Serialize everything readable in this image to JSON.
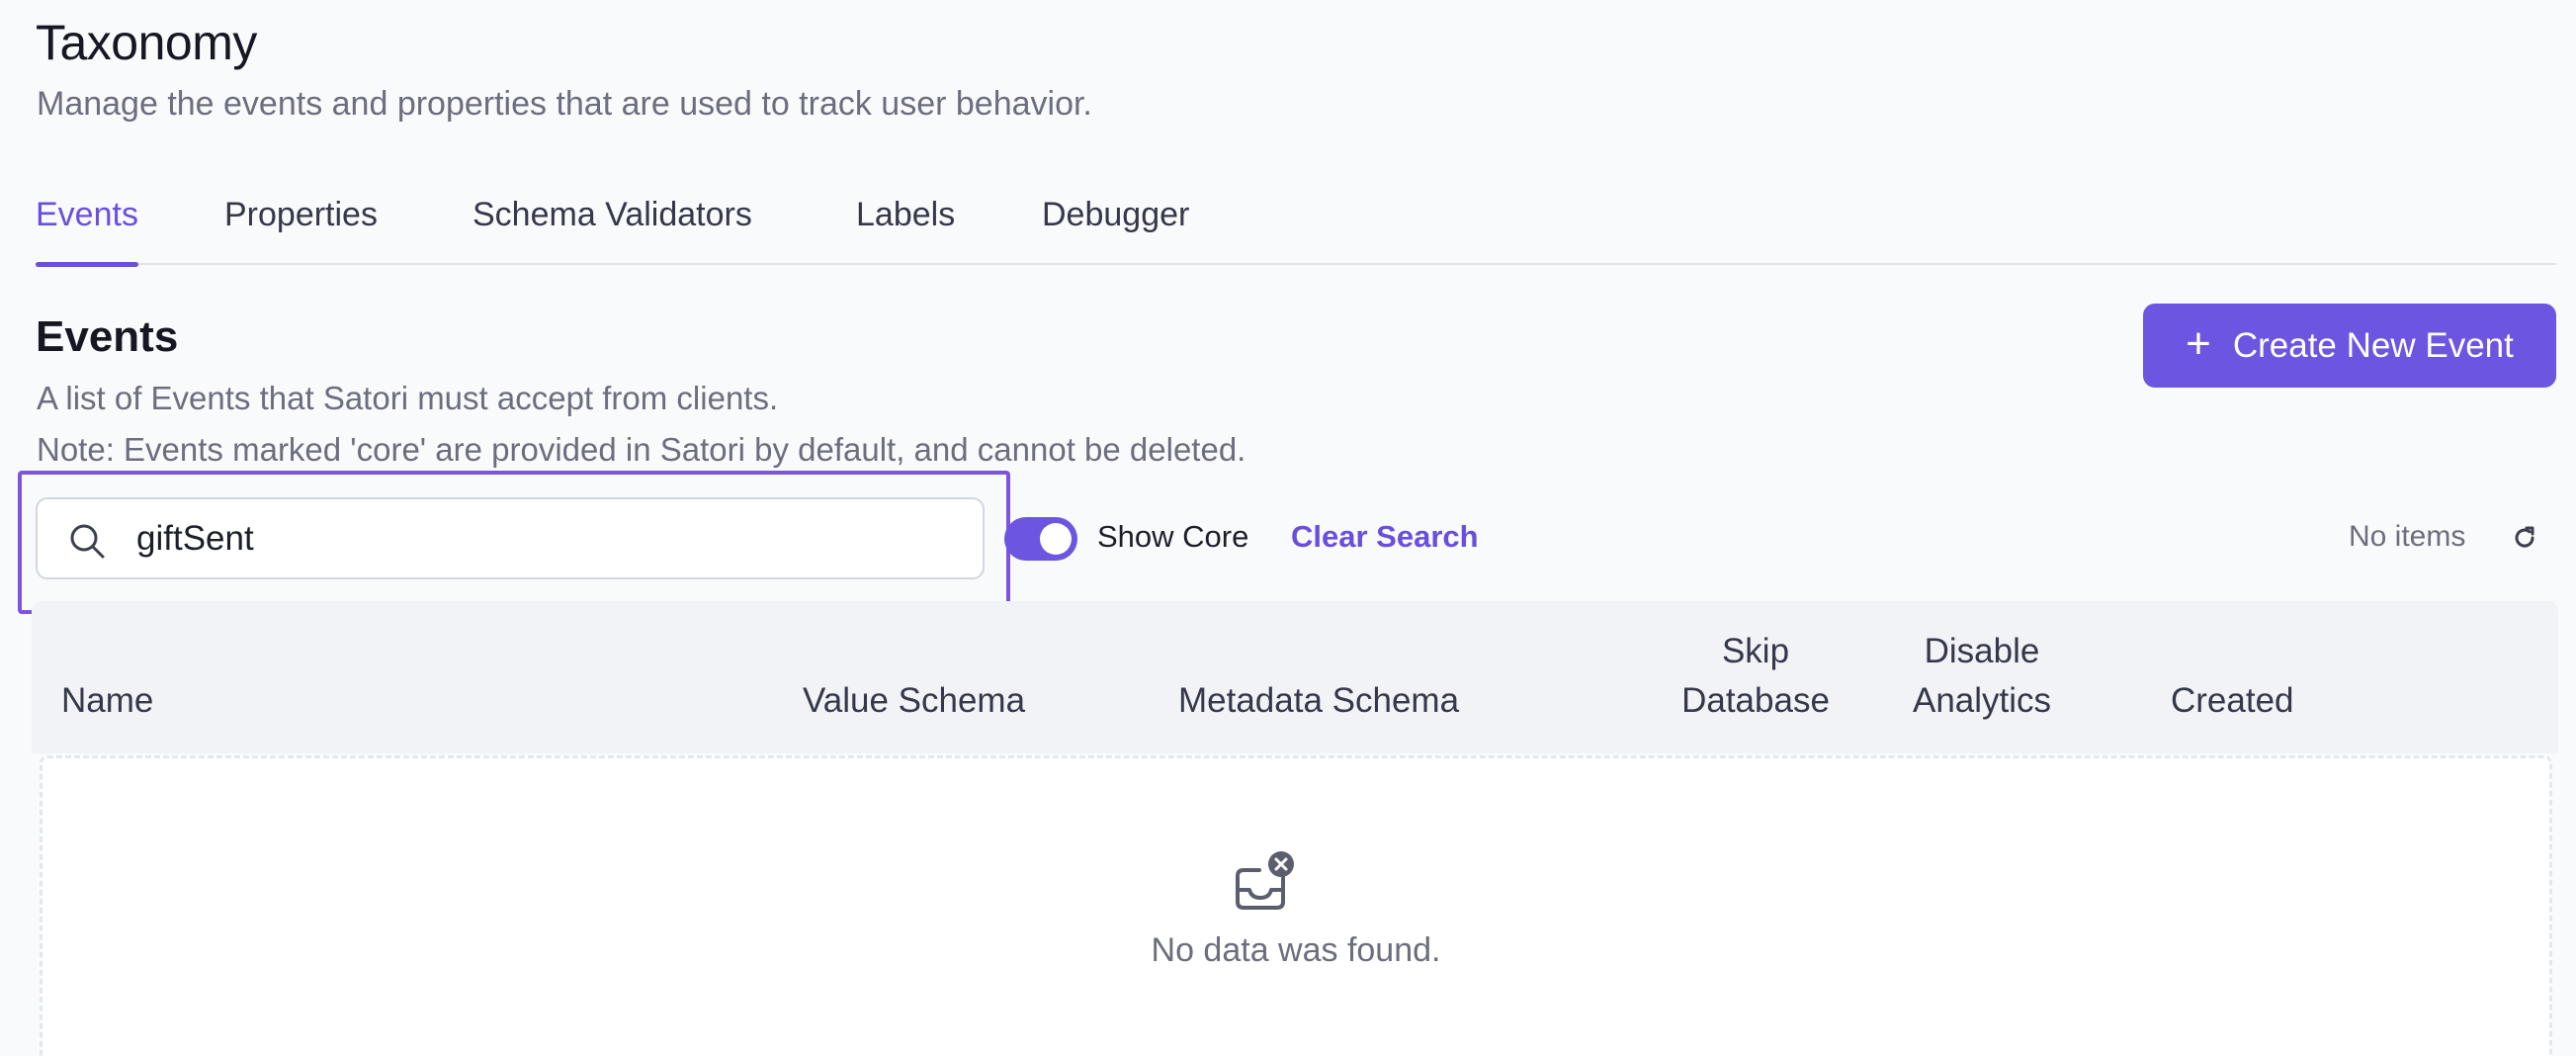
{
  "page": {
    "title": "Taxonomy",
    "subtitle": "Manage the events and properties that are used to track user behavior."
  },
  "tabs": [
    {
      "label": "Events",
      "active": true
    },
    {
      "label": "Properties",
      "active": false
    },
    {
      "label": "Schema Validators",
      "active": false
    },
    {
      "label": "Labels",
      "active": false
    },
    {
      "label": "Debugger",
      "active": false
    }
  ],
  "section": {
    "title": "Events",
    "description": "A list of Events that Satori must accept from clients.",
    "note": "Note: Events marked 'core' are provided in Satori by default, and cannot be deleted.",
    "create_button_label": "Create New Event",
    "create_button_icon": "plus-icon"
  },
  "toolbar": {
    "search_value": "giftSent",
    "search_icon": "search-icon",
    "show_core_label": "Show Core",
    "show_core_enabled": true,
    "clear_search_label": "Clear Search",
    "item_count_text": "No items",
    "refresh_icon": "refresh-icon"
  },
  "table": {
    "columns": [
      {
        "line1": "",
        "line2": "Name"
      },
      {
        "line1": "",
        "line2": "Value Schema"
      },
      {
        "line1": "",
        "line2": "Metadata Schema"
      },
      {
        "line1": "Skip",
        "line2": "Database"
      },
      {
        "line1": "Disable",
        "line2": "Analytics"
      },
      {
        "line1": "",
        "line2": "Created"
      }
    ],
    "empty_icon": "empty-inbox-icon",
    "empty_text": "No data was found."
  },
  "colors": {
    "accent": "#6c55e0",
    "highlight_border": "#7b55e0",
    "muted_text": "#6b6e7d"
  }
}
